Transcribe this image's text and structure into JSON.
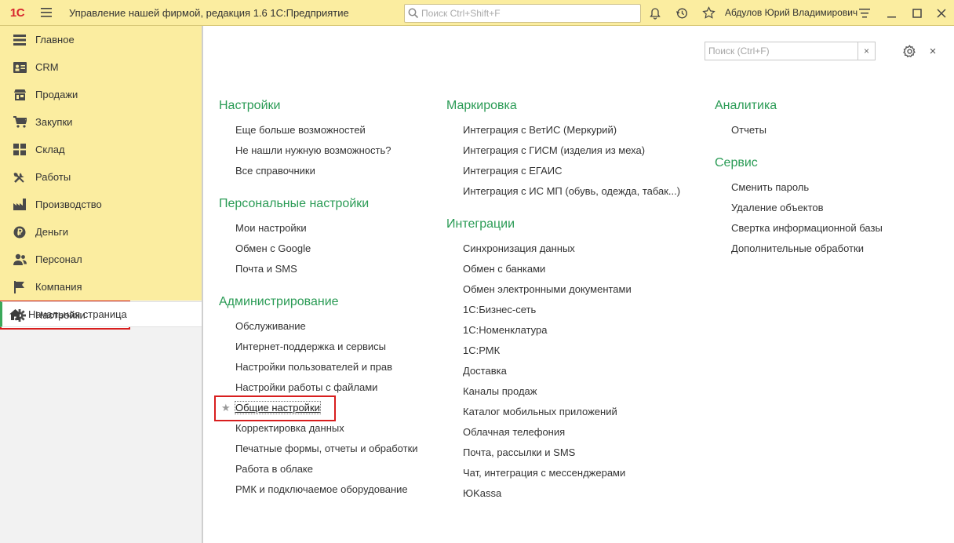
{
  "titlebar": {
    "logo": "1С",
    "title": "Управление нашей фирмой, редакция 1.6 1С:Предприятие",
    "search_placeholder": "Поиск Ctrl+Shift+F",
    "user": "Абдулов Юрий Владимирович"
  },
  "sidebar": {
    "items": [
      {
        "label": "Главное",
        "icon": "list-icon"
      },
      {
        "label": "CRM",
        "icon": "contact-card-icon"
      },
      {
        "label": "Продажи",
        "icon": "shop-icon"
      },
      {
        "label": "Закупки",
        "icon": "cart-icon"
      },
      {
        "label": "Склад",
        "icon": "warehouse-icon"
      },
      {
        "label": "Работы",
        "icon": "tools-icon"
      },
      {
        "label": "Производство",
        "icon": "factory-icon"
      },
      {
        "label": "Деньги",
        "icon": "ruble-icon"
      },
      {
        "label": "Персонал",
        "icon": "people-icon"
      },
      {
        "label": "Компания",
        "icon": "flag-icon"
      },
      {
        "label": "Настройки",
        "icon": "gear-icon",
        "active": true
      }
    ],
    "home": "Начальная страница"
  },
  "main": {
    "search_placeholder": "Поиск (Ctrl+F)",
    "clear": "×",
    "close": "×",
    "columns": [
      {
        "groups": [
          {
            "title": "Настройки",
            "links": [
              "Еще больше возможностей",
              "Не нашли нужную возможность?",
              "Все справочники"
            ]
          },
          {
            "title": "Персональные настройки",
            "links": [
              "Мои настройки",
              "Обмен с Google",
              "Почта и SMS"
            ]
          },
          {
            "title": "Администрирование",
            "links": [
              "Обслуживание",
              "Интернет-поддержка и сервисы",
              "Настройки пользователей и прав",
              "Настройки работы с файлами",
              "Общие настройки",
              "Корректировка данных",
              "Печатные формы, отчеты и обработки",
              "Работа в облаке",
              "РМК и подключаемое оборудование"
            ]
          }
        ]
      },
      {
        "groups": [
          {
            "title": "Маркировка",
            "links": [
              "Интеграция с ВетИС (Меркурий)",
              "Интеграция с ГИСМ (изделия из меха)",
              "Интеграция с ЕГАИС",
              "Интеграция с ИС МП (обувь, одежда, табак...)"
            ]
          },
          {
            "title": "Интеграции",
            "links": [
              "Синхронизация данных",
              "Обмен с банками",
              "Обмен электронными документами",
              "1С:Бизнес-сеть",
              "1С:Номенклатура",
              "1С:РМК",
              "Доставка",
              "Каналы продаж",
              "Каталог мобильных приложений",
              "Облачная телефония",
              "Почта, рассылки и SMS",
              "Чат, интеграция с мессенджерами",
              "ЮKassa"
            ]
          }
        ]
      },
      {
        "groups": [
          {
            "title": "Аналитика",
            "links": [
              "Отчеты"
            ]
          },
          {
            "title": "Сервис",
            "links": [
              "Сменить пароль",
              "Удаление объектов",
              "Свертка информационной базы",
              "Дополнительные обработки"
            ]
          }
        ]
      }
    ],
    "favorite_link": "Общие настройки",
    "favorite_star": "★"
  }
}
